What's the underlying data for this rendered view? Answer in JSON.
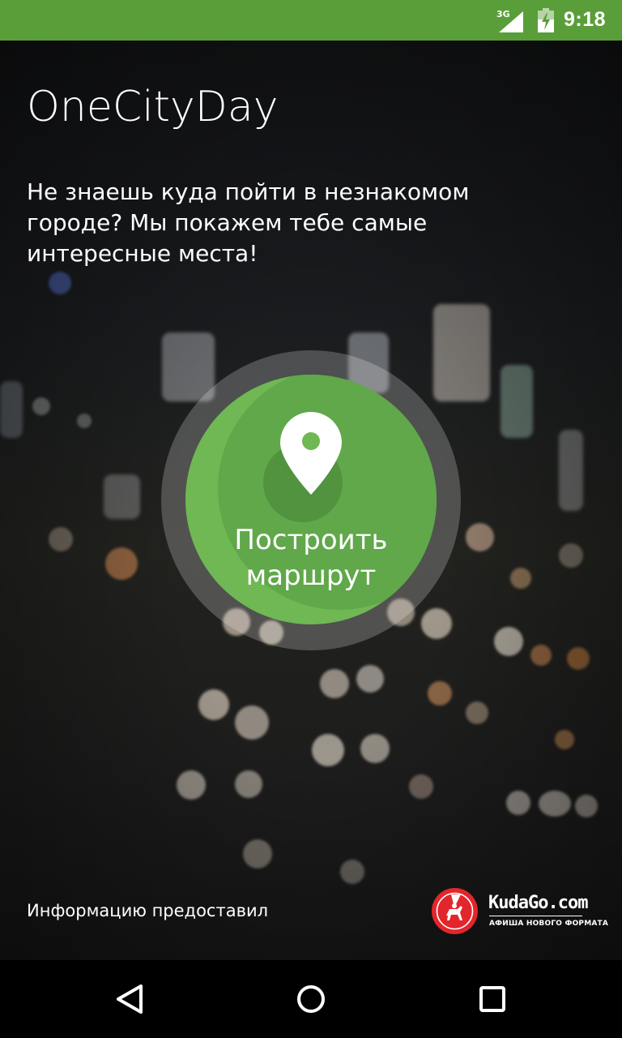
{
  "status_bar": {
    "network_label": "3G",
    "time": "9:18",
    "background_color": "#5a9e3a",
    "icons": [
      "signal-icon",
      "battery-charging-icon"
    ]
  },
  "app": {
    "title": "OneCityDay",
    "tagline": "Не знаешь куда пойти в незнакомом городе? Мы покажем тебе самые интересные места!"
  },
  "route_button": {
    "label_line1": "Построить",
    "label_line2": "маршрут",
    "icon": "location-pin-icon",
    "color": "#6fb854"
  },
  "provider": {
    "text": "Информацию предоставил",
    "logo_brand": "KudaGo.com",
    "logo_tagline": "АФИША НОВОГО ФОРМАТА",
    "logo_color": "#e3262b"
  },
  "nav_bar": {
    "icons": [
      "back-icon",
      "home-icon",
      "recents-icon"
    ]
  }
}
